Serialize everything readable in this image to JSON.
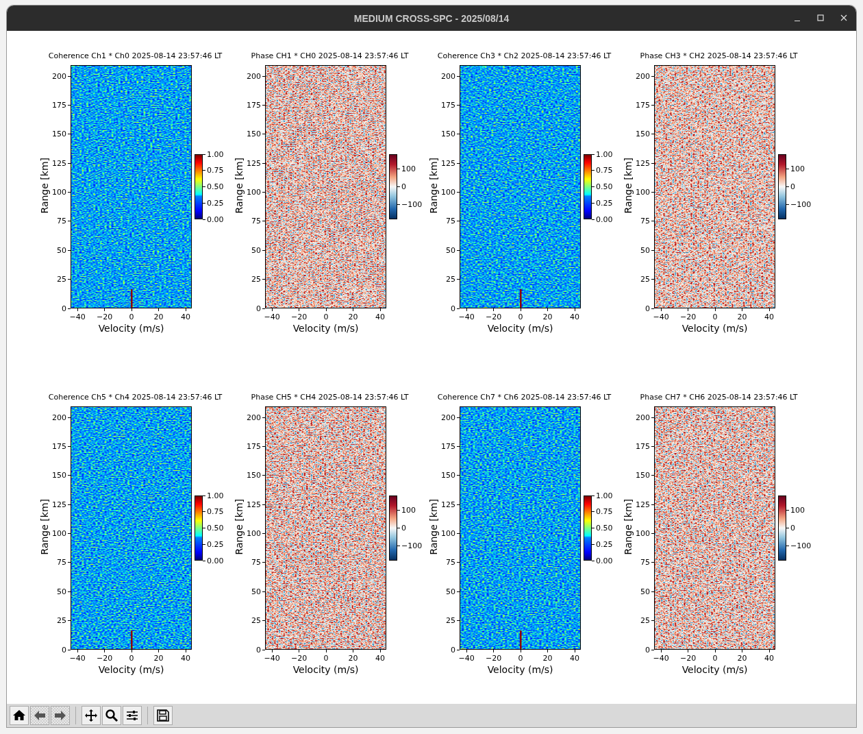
{
  "window": {
    "title": "MEDIUM CROSS-SPC - 2025/08/14"
  },
  "figure": {
    "panels": [
      {
        "kind": "coherence",
        "title": "Coherence Ch1 * Ch0 2025-08-14 23:57:46 LT",
        "ylabel": "Range [km]",
        "xlabel": "Velocity (m/s)",
        "yticks": [
          "200",
          "175",
          "150",
          "125",
          "100",
          "75",
          "50",
          "25",
          "0"
        ],
        "xticks": [
          "−40",
          "−20",
          "0",
          "20",
          "40"
        ],
        "colorbar_ticks": [
          "1.00",
          "0.75",
          "0.50",
          "0.25",
          "0.00"
        ]
      },
      {
        "kind": "phase",
        "title": "Phase CH1 * CH0 2025-08-14 23:57:46 LT",
        "ylabel": "Range [km]",
        "xlabel": "Velocity (m/s)",
        "yticks": [
          "200",
          "175",
          "150",
          "125",
          "100",
          "75",
          "50",
          "25",
          "0"
        ],
        "xticks": [
          "−40",
          "−20",
          "0",
          "20",
          "40"
        ],
        "colorbar_ticks": [
          "100",
          "0",
          "−100"
        ]
      },
      {
        "kind": "coherence",
        "title": "Coherence Ch3 * Ch2 2025-08-14 23:57:46 LT",
        "ylabel": "Range [km]",
        "xlabel": "Velocity (m/s)",
        "yticks": [
          "200",
          "175",
          "150",
          "125",
          "100",
          "75",
          "50",
          "25",
          "0"
        ],
        "xticks": [
          "−40",
          "−20",
          "0",
          "20",
          "40"
        ],
        "colorbar_ticks": [
          "1.00",
          "0.75",
          "0.50",
          "0.25",
          "0.00"
        ]
      },
      {
        "kind": "phase",
        "title": "Phase CH3 * CH2 2025-08-14 23:57:46 LT",
        "ylabel": "Range [km]",
        "xlabel": "Velocity (m/s)",
        "yticks": [
          "200",
          "175",
          "150",
          "125",
          "100",
          "75",
          "50",
          "25",
          "0"
        ],
        "xticks": [
          "−40",
          "−20",
          "0",
          "20",
          "40"
        ],
        "colorbar_ticks": [
          "100",
          "0",
          "−100"
        ]
      },
      {
        "kind": "coherence",
        "title": "Coherence Ch5 * Ch4 2025-08-14 23:57:46 LT",
        "ylabel": "Range [km]",
        "xlabel": "Velocity (m/s)",
        "yticks": [
          "200",
          "175",
          "150",
          "125",
          "100",
          "75",
          "50",
          "25",
          "0"
        ],
        "xticks": [
          "−40",
          "−20",
          "0",
          "20",
          "40"
        ],
        "colorbar_ticks": [
          "1.00",
          "0.75",
          "0.50",
          "0.25",
          "0.00"
        ]
      },
      {
        "kind": "phase",
        "title": "Phase CH5 * CH4 2025-08-14 23:57:46 LT",
        "ylabel": "Range [km]",
        "xlabel": "Velocity (m/s)",
        "yticks": [
          "200",
          "175",
          "150",
          "125",
          "100",
          "75",
          "50",
          "25",
          "0"
        ],
        "xticks": [
          "−40",
          "−20",
          "0",
          "20",
          "40"
        ],
        "colorbar_ticks": [
          "100",
          "0",
          "−100"
        ]
      },
      {
        "kind": "coherence",
        "title": "Coherence Ch7 * Ch6 2025-08-14 23:57:46 LT",
        "ylabel": "Range [km]",
        "xlabel": "Velocity (m/s)",
        "yticks": [
          "200",
          "175",
          "150",
          "125",
          "100",
          "75",
          "50",
          "25",
          "0"
        ],
        "xticks": [
          "−40",
          "−20",
          "0",
          "20",
          "40"
        ],
        "colorbar_ticks": [
          "1.00",
          "0.75",
          "0.50",
          "0.25",
          "0.00"
        ]
      },
      {
        "kind": "phase",
        "title": "Phase CH7 * CH6 2025-08-14 23:57:46 LT",
        "ylabel": "Range [km]",
        "xlabel": "Velocity (m/s)",
        "yticks": [
          "200",
          "175",
          "150",
          "125",
          "100",
          "75",
          "50",
          "25",
          "0"
        ],
        "xticks": [
          "−40",
          "−20",
          "0",
          "20",
          "40"
        ],
        "colorbar_ticks": [
          "100",
          "0",
          "−100"
        ]
      }
    ]
  },
  "toolbar": {
    "items": [
      {
        "kind": "home",
        "disabled": false
      },
      {
        "kind": "back",
        "disabled": true
      },
      {
        "kind": "forward",
        "disabled": true
      },
      {
        "kind": "separator"
      },
      {
        "kind": "pan",
        "disabled": false
      },
      {
        "kind": "zoom",
        "disabled": false
      },
      {
        "kind": "configure",
        "disabled": false
      },
      {
        "kind": "separator"
      },
      {
        "kind": "save",
        "disabled": false
      }
    ]
  }
}
